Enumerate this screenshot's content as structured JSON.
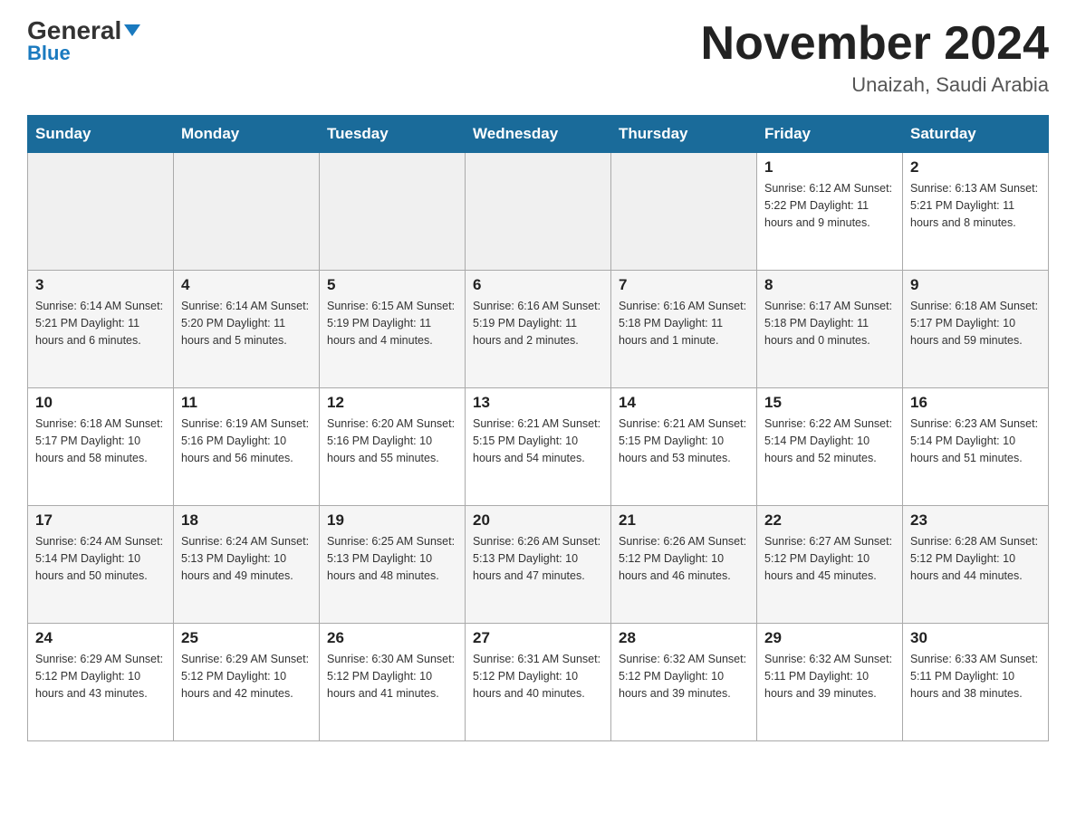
{
  "header": {
    "logo_line1": "General",
    "logo_line2": "Blue",
    "month_title": "November 2024",
    "subtitle": "Unaizah, Saudi Arabia"
  },
  "days_of_week": [
    "Sunday",
    "Monday",
    "Tuesday",
    "Wednesday",
    "Thursday",
    "Friday",
    "Saturday"
  ],
  "weeks": [
    [
      {
        "day": "",
        "info": ""
      },
      {
        "day": "",
        "info": ""
      },
      {
        "day": "",
        "info": ""
      },
      {
        "day": "",
        "info": ""
      },
      {
        "day": "",
        "info": ""
      },
      {
        "day": "1",
        "info": "Sunrise: 6:12 AM\nSunset: 5:22 PM\nDaylight: 11 hours and 9 minutes."
      },
      {
        "day": "2",
        "info": "Sunrise: 6:13 AM\nSunset: 5:21 PM\nDaylight: 11 hours and 8 minutes."
      }
    ],
    [
      {
        "day": "3",
        "info": "Sunrise: 6:14 AM\nSunset: 5:21 PM\nDaylight: 11 hours and 6 minutes."
      },
      {
        "day": "4",
        "info": "Sunrise: 6:14 AM\nSunset: 5:20 PM\nDaylight: 11 hours and 5 minutes."
      },
      {
        "day": "5",
        "info": "Sunrise: 6:15 AM\nSunset: 5:19 PM\nDaylight: 11 hours and 4 minutes."
      },
      {
        "day": "6",
        "info": "Sunrise: 6:16 AM\nSunset: 5:19 PM\nDaylight: 11 hours and 2 minutes."
      },
      {
        "day": "7",
        "info": "Sunrise: 6:16 AM\nSunset: 5:18 PM\nDaylight: 11 hours and 1 minute."
      },
      {
        "day": "8",
        "info": "Sunrise: 6:17 AM\nSunset: 5:18 PM\nDaylight: 11 hours and 0 minutes."
      },
      {
        "day": "9",
        "info": "Sunrise: 6:18 AM\nSunset: 5:17 PM\nDaylight: 10 hours and 59 minutes."
      }
    ],
    [
      {
        "day": "10",
        "info": "Sunrise: 6:18 AM\nSunset: 5:17 PM\nDaylight: 10 hours and 58 minutes."
      },
      {
        "day": "11",
        "info": "Sunrise: 6:19 AM\nSunset: 5:16 PM\nDaylight: 10 hours and 56 minutes."
      },
      {
        "day": "12",
        "info": "Sunrise: 6:20 AM\nSunset: 5:16 PM\nDaylight: 10 hours and 55 minutes."
      },
      {
        "day": "13",
        "info": "Sunrise: 6:21 AM\nSunset: 5:15 PM\nDaylight: 10 hours and 54 minutes."
      },
      {
        "day": "14",
        "info": "Sunrise: 6:21 AM\nSunset: 5:15 PM\nDaylight: 10 hours and 53 minutes."
      },
      {
        "day": "15",
        "info": "Sunrise: 6:22 AM\nSunset: 5:14 PM\nDaylight: 10 hours and 52 minutes."
      },
      {
        "day": "16",
        "info": "Sunrise: 6:23 AM\nSunset: 5:14 PM\nDaylight: 10 hours and 51 minutes."
      }
    ],
    [
      {
        "day": "17",
        "info": "Sunrise: 6:24 AM\nSunset: 5:14 PM\nDaylight: 10 hours and 50 minutes."
      },
      {
        "day": "18",
        "info": "Sunrise: 6:24 AM\nSunset: 5:13 PM\nDaylight: 10 hours and 49 minutes."
      },
      {
        "day": "19",
        "info": "Sunrise: 6:25 AM\nSunset: 5:13 PM\nDaylight: 10 hours and 48 minutes."
      },
      {
        "day": "20",
        "info": "Sunrise: 6:26 AM\nSunset: 5:13 PM\nDaylight: 10 hours and 47 minutes."
      },
      {
        "day": "21",
        "info": "Sunrise: 6:26 AM\nSunset: 5:12 PM\nDaylight: 10 hours and 46 minutes."
      },
      {
        "day": "22",
        "info": "Sunrise: 6:27 AM\nSunset: 5:12 PM\nDaylight: 10 hours and 45 minutes."
      },
      {
        "day": "23",
        "info": "Sunrise: 6:28 AM\nSunset: 5:12 PM\nDaylight: 10 hours and 44 minutes."
      }
    ],
    [
      {
        "day": "24",
        "info": "Sunrise: 6:29 AM\nSunset: 5:12 PM\nDaylight: 10 hours and 43 minutes."
      },
      {
        "day": "25",
        "info": "Sunrise: 6:29 AM\nSunset: 5:12 PM\nDaylight: 10 hours and 42 minutes."
      },
      {
        "day": "26",
        "info": "Sunrise: 6:30 AM\nSunset: 5:12 PM\nDaylight: 10 hours and 41 minutes."
      },
      {
        "day": "27",
        "info": "Sunrise: 6:31 AM\nSunset: 5:12 PM\nDaylight: 10 hours and 40 minutes."
      },
      {
        "day": "28",
        "info": "Sunrise: 6:32 AM\nSunset: 5:12 PM\nDaylight: 10 hours and 39 minutes."
      },
      {
        "day": "29",
        "info": "Sunrise: 6:32 AM\nSunset: 5:11 PM\nDaylight: 10 hours and 39 minutes."
      },
      {
        "day": "30",
        "info": "Sunrise: 6:33 AM\nSunset: 5:11 PM\nDaylight: 10 hours and 38 minutes."
      }
    ]
  ]
}
